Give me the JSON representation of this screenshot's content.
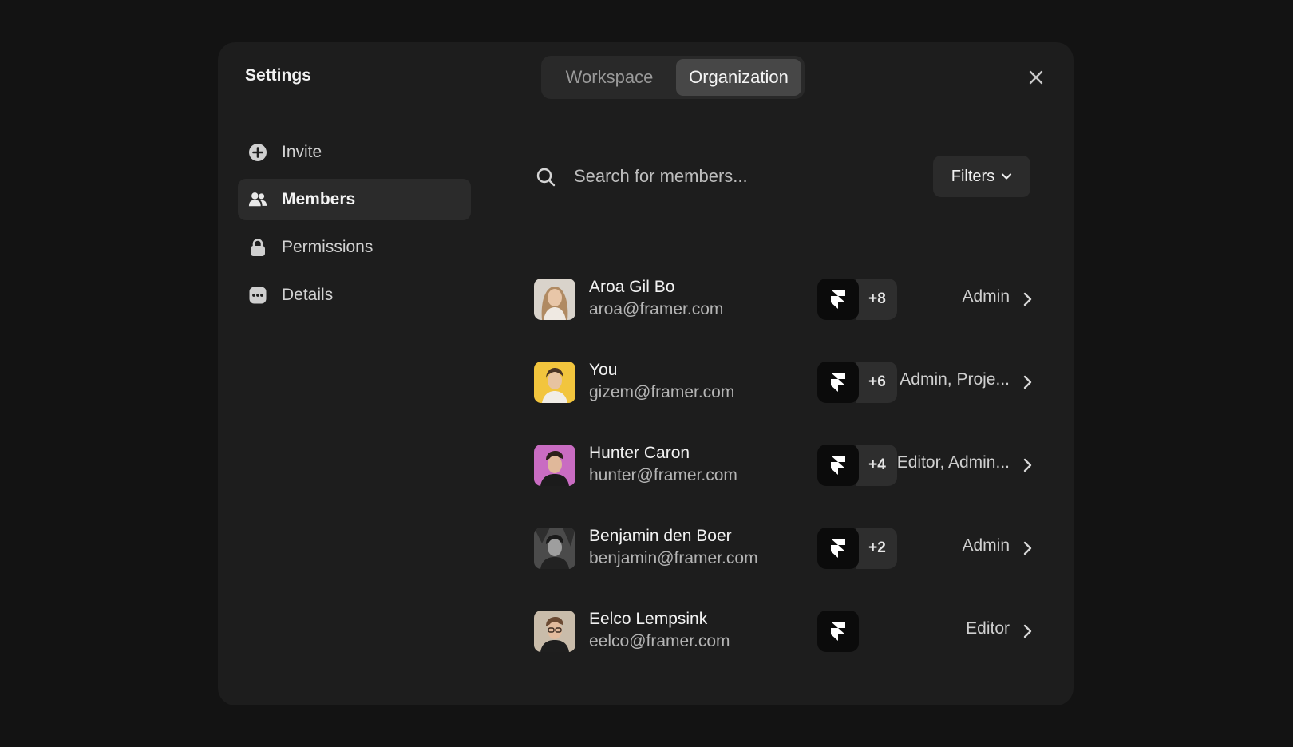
{
  "header": {
    "title": "Settings",
    "tabs": [
      {
        "label": "Workspace",
        "active": false
      },
      {
        "label": "Organization",
        "active": true
      }
    ]
  },
  "sidebar": {
    "items": [
      {
        "label": "Invite",
        "icon": "plus-circle-icon",
        "active": false
      },
      {
        "label": "Members",
        "icon": "users-icon",
        "active": true
      },
      {
        "label": "Permissions",
        "icon": "lock-icon",
        "active": false
      },
      {
        "label": "Details",
        "icon": "dots-square-icon",
        "active": false
      }
    ]
  },
  "search": {
    "placeholder": "Search for members...",
    "filters_label": "Filters"
  },
  "members": [
    {
      "name": "Aroa Gil Bo",
      "email": "aroa@framer.com",
      "count": "+8",
      "role": "Admin",
      "avatar_color": "#d8cfc4"
    },
    {
      "name": "You",
      "email": "gizem@framer.com",
      "count": "+6",
      "role": "Admin, Proje...",
      "avatar_color": "#f2c53d"
    },
    {
      "name": "Hunter Caron",
      "email": "hunter@framer.com",
      "count": "+4",
      "role": "Editor, Admin...",
      "avatar_color": "#c86ac0"
    },
    {
      "name": "Benjamin den Boer",
      "email": "benjamin@framer.com",
      "count": "+2",
      "role": "Admin",
      "avatar_color": "#555555"
    },
    {
      "name": "Eelco Lempsink",
      "email": "eelco@framer.com",
      "count": "",
      "role": "Editor",
      "avatar_color": "#c7b8a6"
    }
  ],
  "colors": {
    "background": "#131313",
    "modal": "#1d1d1d",
    "active_item": "#2b2b2b"
  }
}
